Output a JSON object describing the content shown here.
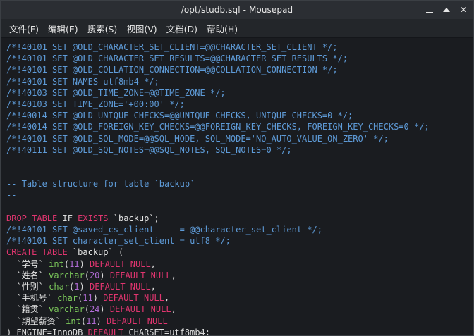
{
  "window": {
    "title": "/opt/studb.sql - Mousepad",
    "controls": [
      "minimize",
      "maximize",
      "close"
    ],
    "close_glyph": "✕"
  },
  "menu": [
    {
      "id": "file",
      "label": "文件(F)"
    },
    {
      "id": "edit",
      "label": "编辑(E)"
    },
    {
      "id": "search",
      "label": "搜索(S)"
    },
    {
      "id": "view",
      "label": "视图(V)"
    },
    {
      "id": "document",
      "label": "文档(D)"
    },
    {
      "id": "help",
      "label": "帮助(H)"
    }
  ],
  "colors": {
    "comment": "#5e9bd8",
    "keyword": "#e0356f",
    "type": "#7bc85a",
    "number": "#b06bd4",
    "background": "#1a1c20"
  },
  "lines": [
    [
      [
        "t-comment",
        "/*!40101 SET @OLD_CHARACTER_SET_CLIENT=@@CHARACTER_SET_CLIENT */;"
      ]
    ],
    [
      [
        "t-comment",
        "/*!40101 SET @OLD_CHARACTER_SET_RESULTS=@@CHARACTER_SET_RESULTS */;"
      ]
    ],
    [
      [
        "t-comment",
        "/*!40101 SET @OLD_COLLATION_CONNECTION=@@COLLATION_CONNECTION */;"
      ]
    ],
    [
      [
        "t-comment",
        "/*!40101 SET NAMES utf8mb4 */;"
      ]
    ],
    [
      [
        "t-comment",
        "/*!40103 SET @OLD_TIME_ZONE=@@TIME_ZONE */;"
      ]
    ],
    [
      [
        "t-comment",
        "/*!40103 SET TIME_ZONE='+00:00' */;"
      ]
    ],
    [
      [
        "t-comment",
        "/*!40014 SET @OLD_UNIQUE_CHECKS=@@UNIQUE_CHECKS, UNIQUE_CHECKS=0 */;"
      ]
    ],
    [
      [
        "t-comment",
        "/*!40014 SET @OLD_FOREIGN_KEY_CHECKS=@@FOREIGN_KEY_CHECKS, FOREIGN_KEY_CHECKS=0 */;"
      ]
    ],
    [
      [
        "t-comment",
        "/*!40101 SET @OLD_SQL_MODE=@@SQL_MODE, SQL_MODE='NO_AUTO_VALUE_ON_ZERO' */;"
      ]
    ],
    [
      [
        "t-comment",
        "/*!40111 SET @OLD_SQL_NOTES=@@SQL_NOTES, SQL_NOTES=0 */;"
      ]
    ],
    [
      [
        "t-plain",
        ""
      ]
    ],
    [
      [
        "t-comment",
        "--"
      ]
    ],
    [
      [
        "t-comment",
        "-- Table structure for table `backup`"
      ]
    ],
    [
      [
        "t-comment",
        "--"
      ]
    ],
    [
      [
        "t-plain",
        ""
      ]
    ],
    [
      [
        "t-kw",
        "DROP TABLE"
      ],
      [
        "t-plain",
        " IF "
      ],
      [
        "t-kw",
        "EXISTS"
      ],
      [
        "t-ident",
        " `backup`"
      ],
      [
        "t-plain",
        ";"
      ]
    ],
    [
      [
        "t-comment",
        "/*!40101 SET @saved_cs_client     = @@character_set_client */;"
      ]
    ],
    [
      [
        "t-comment",
        "/*!40101 SET character_set_client = utf8 */;"
      ]
    ],
    [
      [
        "t-kw",
        "CREATE TABLE"
      ],
      [
        "t-ident",
        " `backup`"
      ],
      [
        "t-plain",
        " ("
      ]
    ],
    [
      [
        "t-ident",
        "  `学号`"
      ],
      [
        "t-plain",
        " "
      ],
      [
        "t-type",
        "int"
      ],
      [
        "t-plain",
        "("
      ],
      [
        "t-num",
        "11"
      ],
      [
        "t-plain",
        ") "
      ],
      [
        "t-kw",
        "DEFAULT NULL"
      ],
      [
        "t-plain",
        ","
      ]
    ],
    [
      [
        "t-ident",
        "  `姓名`"
      ],
      [
        "t-plain",
        " "
      ],
      [
        "t-type",
        "varchar"
      ],
      [
        "t-plain",
        "("
      ],
      [
        "t-num",
        "20"
      ],
      [
        "t-plain",
        ") "
      ],
      [
        "t-kw",
        "DEFAULT NULL"
      ],
      [
        "t-plain",
        ","
      ]
    ],
    [
      [
        "t-ident",
        "  `性别`"
      ],
      [
        "t-plain",
        " "
      ],
      [
        "t-type",
        "char"
      ],
      [
        "t-plain",
        "("
      ],
      [
        "t-num",
        "1"
      ],
      [
        "t-plain",
        ") "
      ],
      [
        "t-kw",
        "DEFAULT NULL"
      ],
      [
        "t-plain",
        ","
      ]
    ],
    [
      [
        "t-ident",
        "  `手机号`"
      ],
      [
        "t-plain",
        " "
      ],
      [
        "t-type",
        "char"
      ],
      [
        "t-plain",
        "("
      ],
      [
        "t-num",
        "11"
      ],
      [
        "t-plain",
        ") "
      ],
      [
        "t-kw",
        "DEFAULT NULL"
      ],
      [
        "t-plain",
        ","
      ]
    ],
    [
      [
        "t-ident",
        "  `籍贯`"
      ],
      [
        "t-plain",
        " "
      ],
      [
        "t-type",
        "varchar"
      ],
      [
        "t-plain",
        "("
      ],
      [
        "t-num",
        "24"
      ],
      [
        "t-plain",
        ") "
      ],
      [
        "t-kw",
        "DEFAULT NULL"
      ],
      [
        "t-plain",
        ","
      ]
    ],
    [
      [
        "t-ident",
        "  `期望薪资`"
      ],
      [
        "t-plain",
        " "
      ],
      [
        "t-type",
        "int"
      ],
      [
        "t-plain",
        "("
      ],
      [
        "t-num",
        "11"
      ],
      [
        "t-plain",
        ") "
      ],
      [
        "t-kw",
        "DEFAULT NULL"
      ]
    ],
    [
      [
        "t-plain",
        ") ENGINE=InnoDB "
      ],
      [
        "t-kw",
        "DEFAULT"
      ],
      [
        "t-plain",
        " CHARSET=utf8mb4;"
      ]
    ]
  ]
}
